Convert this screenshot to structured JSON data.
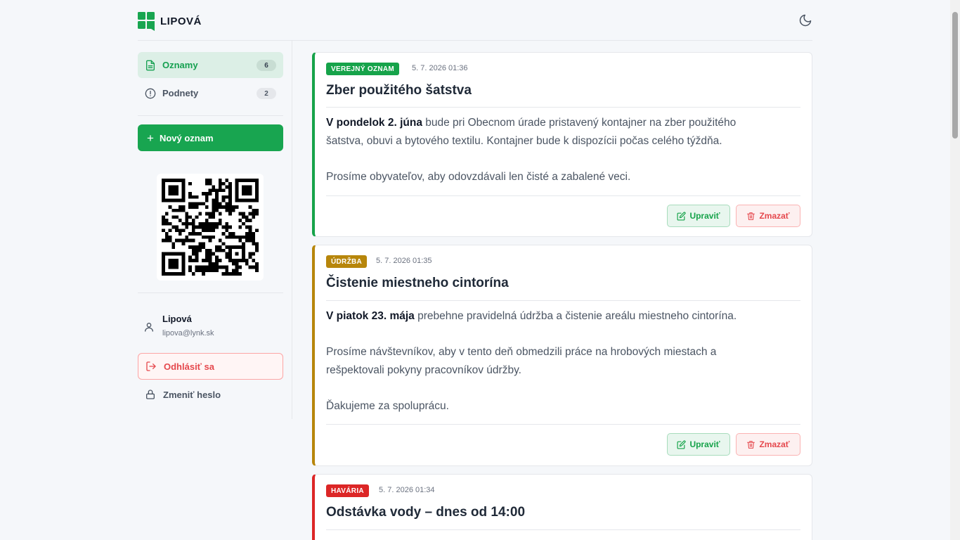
{
  "app": {
    "logo_text": "LIPOVÁ"
  },
  "nav": [
    {
      "label": "Oznamy",
      "count": "6"
    },
    {
      "label": "Podnety",
      "count": "2"
    }
  ],
  "new_button": {
    "label": "Nový oznam"
  },
  "user": {
    "name": "Lipová",
    "email": "lipova@lynk.sk"
  },
  "logout": {
    "label": "Odhlásiť sa"
  },
  "change_password": {
    "label": "Zmeniť heslo"
  },
  "buttons": {
    "edit": "Upraviť",
    "delete": "Zmazať"
  },
  "colors": {
    "accent": "#18a550",
    "verejny": "#16a34a",
    "udrzba": "#b7860b",
    "havaria": "#dc2626"
  },
  "posts": [
    {
      "tag": "VEREJNÝ OZNAM",
      "date": "5. 7. 2026 01:36",
      "title": "Zber použitého šatstva",
      "lines": [
        {
          "bold": "V pondelok 2. júna",
          "text": " bude pri Obecnom úrade pristavený kontajner na zber použitého"
        },
        {
          "bold": "",
          "text": "šatstva, obuvi a bytového textilu. Kontajner bude k dispozícii počas celého týždňa."
        },
        {
          "bold": "",
          "text": "Prosíme obyvateľov, aby odovzdávali len čisté a zabalené veci."
        }
      ]
    },
    {
      "tag": "ÚDRŽBA",
      "date": "5. 7. 2026 01:35",
      "title": "Čistenie miestneho cintorína",
      "lines": [
        {
          "bold": "V piatok 23. mája",
          "text": " prebehne pravidelná údržba a čistenie areálu miestneho cintorína."
        },
        {
          "bold": "",
          "text": "Prosíme návštevníkov, aby v tento deň obmedzili práce na hrobových miestach a"
        },
        {
          "bold": "",
          "text": "rešpektovali pokyny pracovníkov údržby."
        },
        {
          "bold": "",
          "text": "Ďakujeme za spoluprácu."
        }
      ]
    },
    {
      "tag": "HAVÁRIA",
      "date": "5. 7. 2026 01:34",
      "title": "Odstávka vody – dnes od 14:00",
      "lines": []
    }
  ]
}
